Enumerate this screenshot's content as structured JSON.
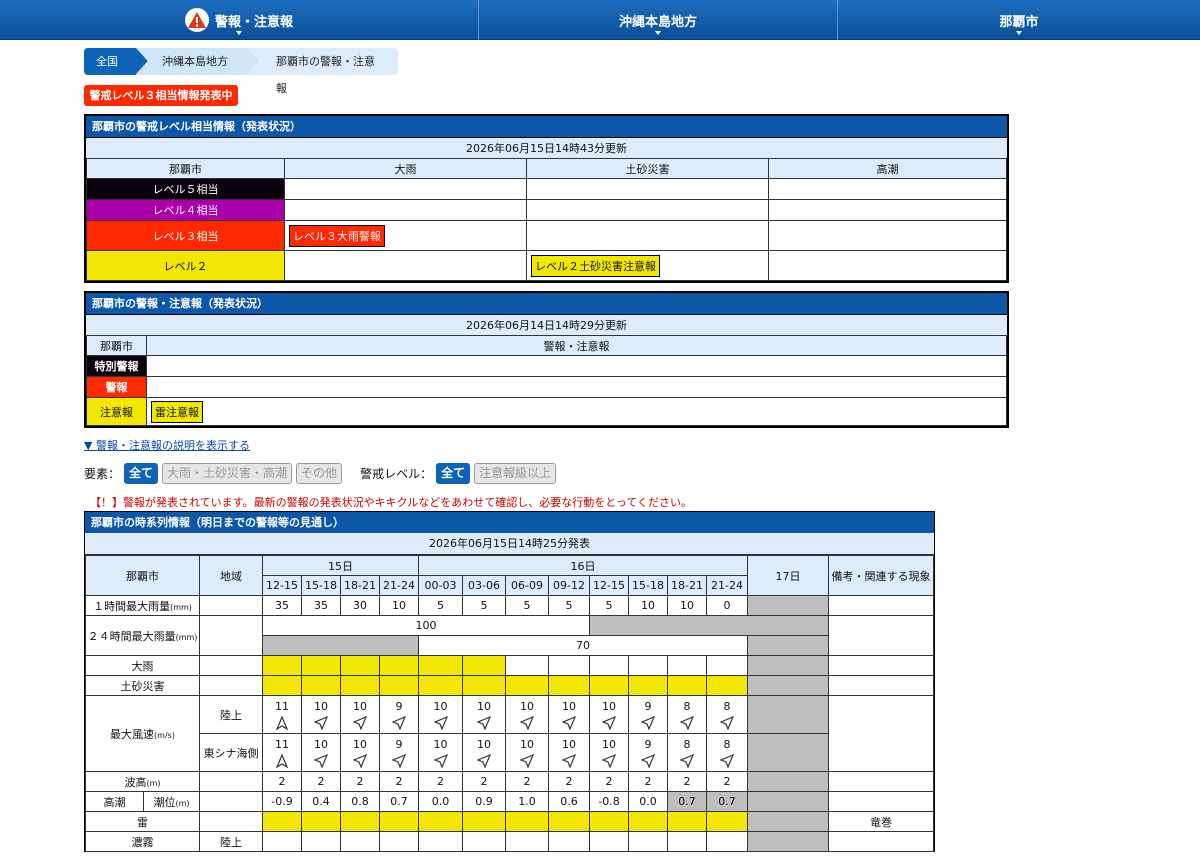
{
  "nav": {
    "items": [
      "警報・注意報",
      "沖縄本島地方",
      "那覇市"
    ]
  },
  "breadcrumb": [
    "全国",
    "沖縄本島地方",
    "那覇市の警報・注意報"
  ],
  "alert_bar": "警戒レベル３相当情報発表中",
  "level_table": {
    "title": "那覇市の警戒レベル相当情報（発表状況）",
    "updated": "2026年06月15日14時43分更新",
    "columns": [
      "那覇市",
      "大雨",
      "土砂災害",
      "高潮"
    ],
    "rows": [
      {
        "label": "レベル５相当",
        "cells": [
          "",
          "",
          ""
        ]
      },
      {
        "label": "レベル４相当",
        "cells": [
          "",
          "",
          ""
        ]
      },
      {
        "label": "レベル３相当",
        "cells": [
          "レベル３大雨警報",
          "",
          ""
        ]
      },
      {
        "label": "レベル２",
        "cells": [
          "",
          "レベル２土砂災害注意報",
          ""
        ]
      }
    ]
  },
  "warn_table": {
    "title": "那覇市の警報・注意報（発表状況）",
    "updated": "2026年06月14日14時29分更新",
    "columns": [
      "那覇市",
      "警報・注意報"
    ],
    "rows": [
      {
        "label": "特別警報",
        "value": ""
      },
      {
        "label": "警報",
        "value": ""
      },
      {
        "label": "注意報",
        "value": "雷注意報"
      }
    ]
  },
  "explain_link": "▼ 警報・注意報の説明を表示する",
  "filters": {
    "element_label": "要素：",
    "element_buttons": [
      "全て",
      "大雨・土砂災害・高潮",
      "その他"
    ],
    "level_label": "警戒レベル：",
    "level_buttons": [
      "全て",
      "注意報級以上"
    ]
  },
  "notice": "【！】警報が発表されています。最新の警報の発表状況やキキクルなどをあわせて確認し、必要な行動をとってください。",
  "timeseries": {
    "title": "那覇市の時系列情報（明日までの警報等の見通し）",
    "updated": "2026年06月15日14時25分発表",
    "head": {
      "area": "那覇市",
      "region": "地域",
      "day15": "15日",
      "day16": "16日",
      "day17": "17日",
      "remarks": "備考・関連する現象",
      "slots": [
        "12-15",
        "15-18",
        "18-21",
        "21-24",
        "00-03",
        "03-06",
        "06-09",
        "09-12",
        "12-15",
        "15-18",
        "18-21",
        "21-24"
      ]
    },
    "rain1h": {
      "label": "１時間最大雨量",
      "unit": "(mm)",
      "values": [
        "35",
        "35",
        "30",
        "10",
        "5",
        "5",
        "5",
        "5",
        "5",
        "10",
        "10",
        "0"
      ]
    },
    "rain24h": {
      "label": "２４時間最大雨量",
      "unit": "(mm)",
      "v1": "100",
      "v2": "70"
    },
    "heavy_rain": {
      "label": "大雨"
    },
    "landslide": {
      "label": "土砂災害"
    },
    "wind": {
      "label": "最大風速",
      "unit": "(m/s)",
      "land": {
        "label": "陸上",
        "values": [
          "11",
          "10",
          "10",
          "9",
          "10",
          "10",
          "10",
          "10",
          "10",
          "9",
          "8",
          "8"
        ]
      },
      "sea": {
        "label": "東シナ海側",
        "values": [
          "11",
          "10",
          "10",
          "9",
          "10",
          "10",
          "10",
          "10",
          "10",
          "9",
          "8",
          "8"
        ]
      }
    },
    "wave": {
      "label": "波高",
      "unit": "(m)",
      "values": [
        "2",
        "2",
        "2",
        "2",
        "2",
        "2",
        "2",
        "2",
        "2",
        "2",
        "2",
        "2"
      ]
    },
    "tide": {
      "label": "高潮",
      "sublabel": "潮位",
      "unit": "(m)",
      "values": [
        "-0.9",
        "0.4",
        "0.8",
        "0.7",
        "0.0",
        "0.9",
        "1.0",
        "0.6",
        "-0.8",
        "0.0",
        "0.7",
        "0.7"
      ]
    },
    "thunder": {
      "label": "雷",
      "remark": "竜巻"
    },
    "fog": {
      "label": "濃霧",
      "sublabel": "陸上"
    }
  }
}
